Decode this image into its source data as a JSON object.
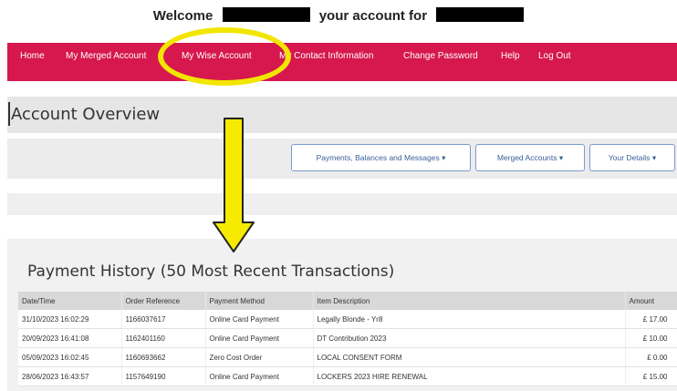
{
  "welcome": {
    "prefix": "Welcome",
    "middle": "your account for"
  },
  "nav": {
    "items": [
      {
        "label": "Home"
      },
      {
        "label": "My Merged Account"
      },
      {
        "label": "My Wise Account"
      },
      {
        "label": "My Contact Information"
      },
      {
        "label": "Change Password"
      },
      {
        "label": "Help"
      },
      {
        "label": "Log Out"
      }
    ]
  },
  "overview": {
    "title": "Account Overview"
  },
  "buttons": {
    "payments": "Payments, Balances and Messages",
    "merged": "Merged Accounts",
    "details": "Your Details"
  },
  "payment_history": {
    "title": "Payment History (50 Most Recent Transactions)",
    "columns": [
      "Date/Time",
      "Order Reference",
      "Payment Method",
      "Item Description",
      "Amount"
    ],
    "rows": [
      [
        "31/10/2023 16:02:29",
        "1166037617",
        "Online Card Payment",
        "Legally Blonde - Yr8",
        "£ 17.00"
      ],
      [
        "20/09/2023 16:41:08",
        "1162401160",
        "Online Card Payment",
        "DT Contribution 2023",
        "£ 10.00"
      ],
      [
        "05/09/2023 16:02:45",
        "1160693662",
        "Zero Cost Order",
        "LOCAL CONSENT FORM",
        "£ 0.00"
      ],
      [
        "28/06/2023 16:43:57",
        "1157649190",
        "Online Card Payment",
        "LOCKERS 2023 HIRE RENEWAL",
        "£ 15.00"
      ]
    ]
  },
  "annotation_colors": {
    "highlight": "#f2e600",
    "nav_background": "#d6184f"
  }
}
